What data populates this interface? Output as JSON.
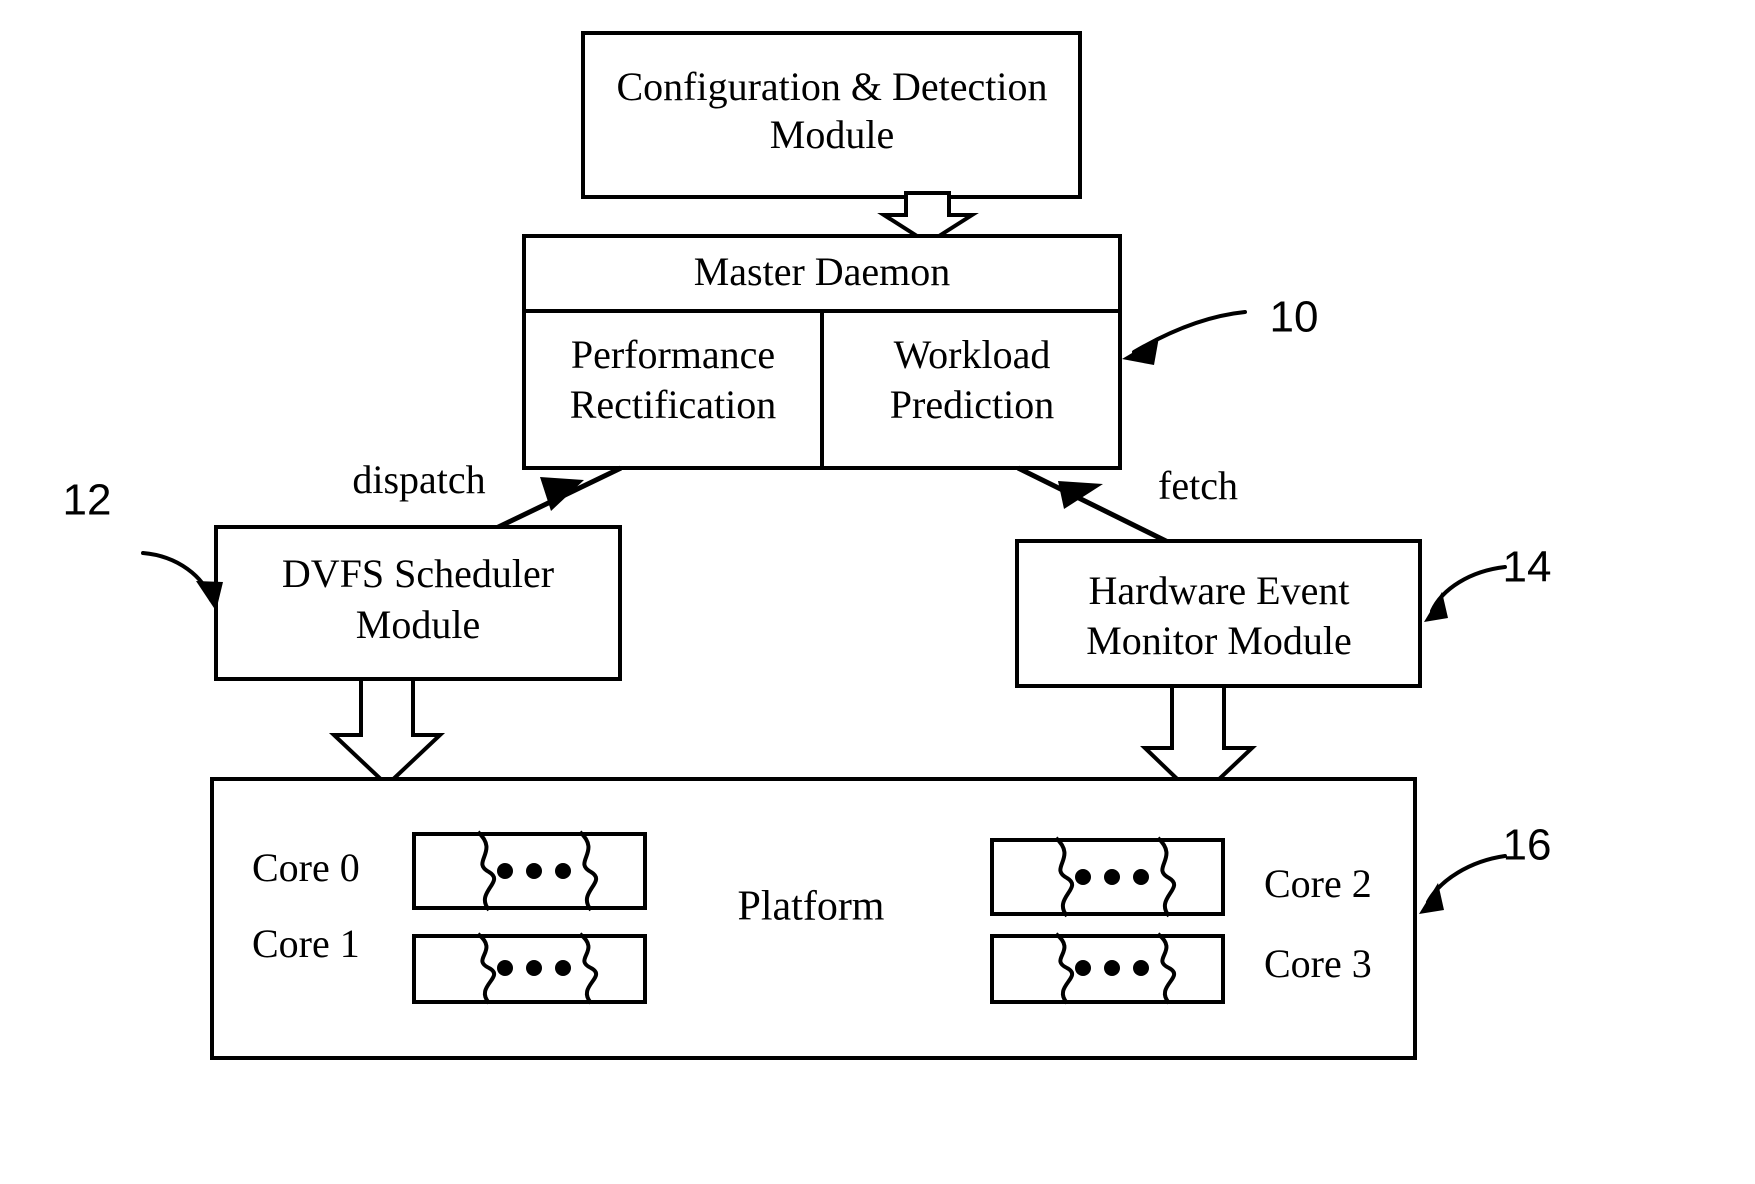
{
  "figure": {
    "type": "block-diagram",
    "title": "DVFS system architecture block diagram",
    "background_color": "#ffffff",
    "line_color": "#000000"
  },
  "blocks": {
    "config_detection": {
      "line1": "Configuration & Detection",
      "line2": "Module"
    },
    "master_daemon": {
      "header": "Master Daemon",
      "left_cell_line1": "Performance",
      "left_cell_line2": "Rectification",
      "right_cell_line1": "Workload",
      "right_cell_line2": "Prediction"
    },
    "dvfs_scheduler": {
      "line1": "DVFS Scheduler",
      "line2": "Module"
    },
    "hardware_event_monitor": {
      "line1": "Hardware Event",
      "line2": "Monitor Module"
    },
    "platform": {
      "label": "Platform"
    }
  },
  "edge_labels": {
    "dispatch": "dispatch",
    "fetch": "fetch"
  },
  "cores": {
    "core0": "Core 0",
    "core1": "Core 1",
    "core2": "Core 2",
    "core3": "Core 3",
    "ellipsis_dot_count": 3
  },
  "reference_numbers": {
    "master_daemon": "10",
    "dvfs_scheduler": "12",
    "hardware_event_monitor": "14",
    "platform": "16"
  }
}
